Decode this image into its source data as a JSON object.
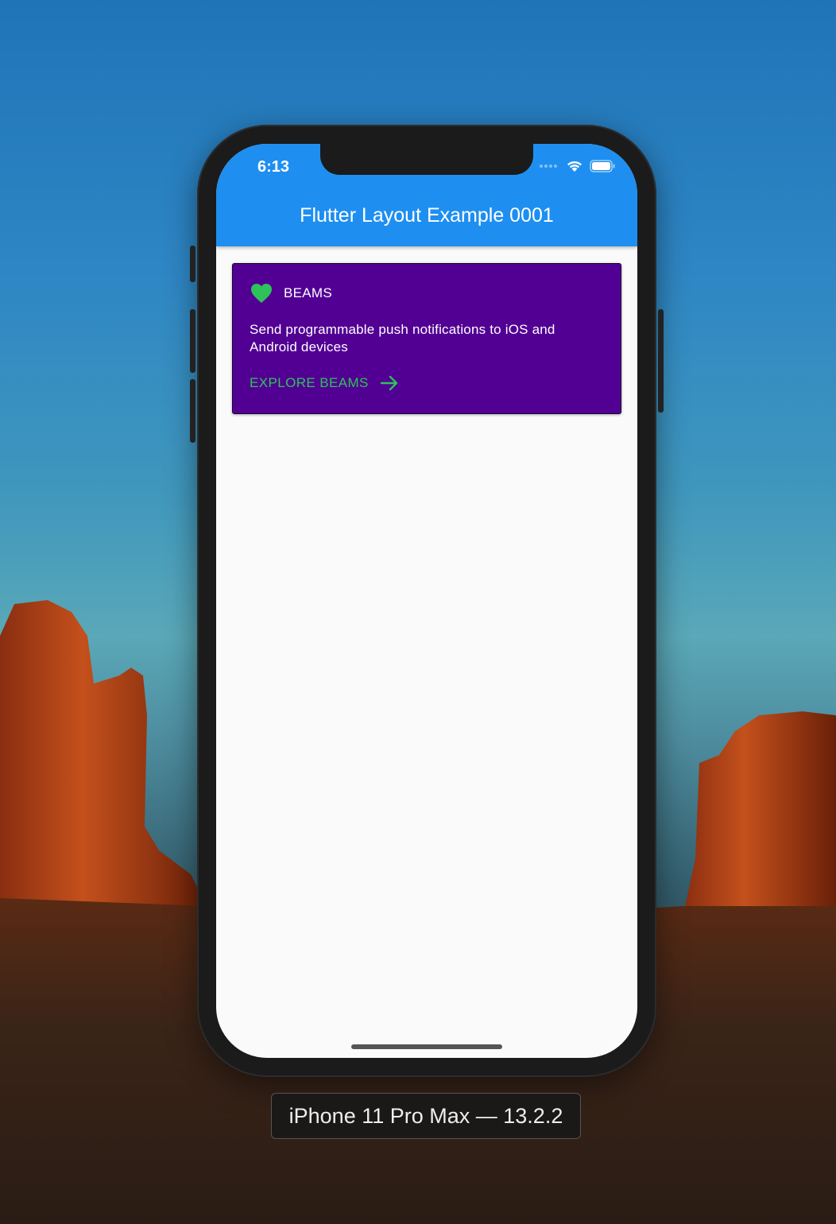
{
  "status_bar": {
    "time": "6:13"
  },
  "app_bar": {
    "title": "Flutter Layout Example 0001"
  },
  "card": {
    "icon": "heart-icon",
    "title": "BEAMS",
    "description": "Send programmable push notifications to iOS and Android devices",
    "action_label": "EXPLORE BEAMS",
    "action_icon": "arrow-right-icon"
  },
  "device_label": "iPhone 11 Pro Max — 13.2.2",
  "colors": {
    "app_bar": "#1e8ff0",
    "card_background": "#520094",
    "accent_green": "#2ec25a",
    "screen_background": "#fafafa"
  }
}
